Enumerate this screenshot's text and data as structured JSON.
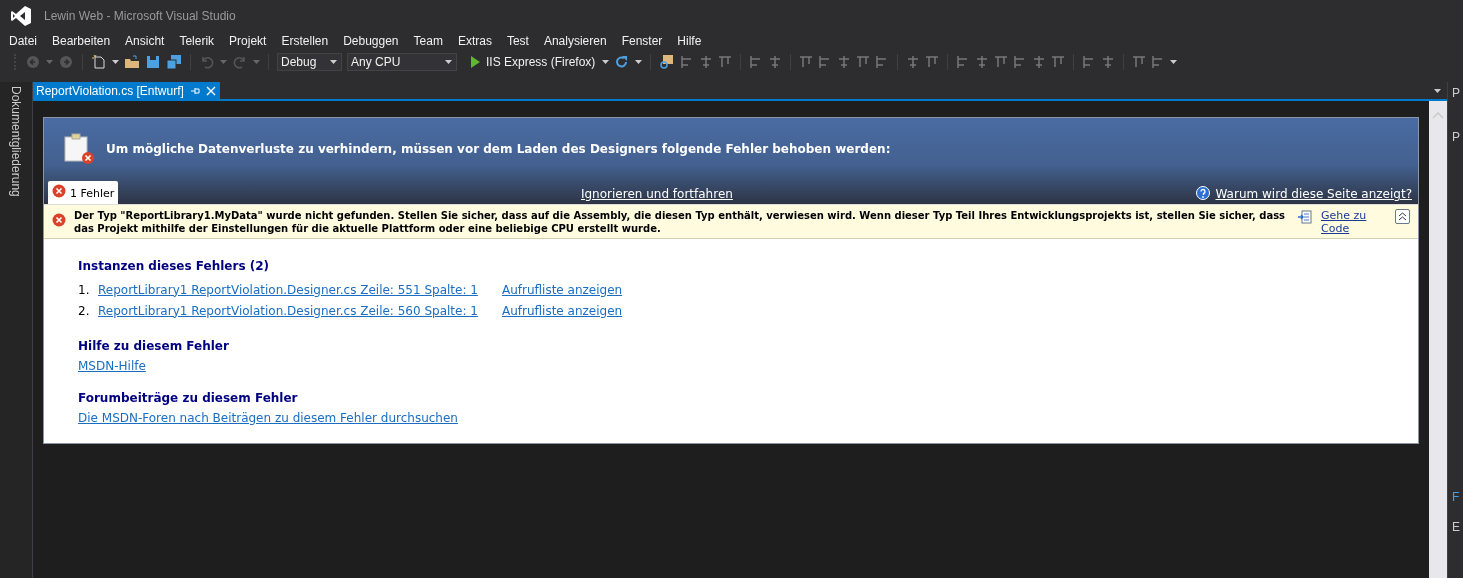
{
  "window": {
    "title": "Lewin Web - Microsoft Visual Studio"
  },
  "menu": [
    "Datei",
    "Bearbeiten",
    "Ansicht",
    "Telerik",
    "Projekt",
    "Erstellen",
    "Debuggen",
    "Team",
    "Extras",
    "Test",
    "Analysieren",
    "Fenster",
    "Hilfe"
  ],
  "toolbar": {
    "configuration": "Debug",
    "platform": "Any CPU",
    "run_target": "IIS Express (Firefox)"
  },
  "tabs": [
    {
      "label": "ReportViolation.cs [Entwurf]",
      "selected": true
    }
  ],
  "side_panel": {
    "label": "Dokumentgliederung"
  },
  "designer_error": {
    "heading": "Um mögliche Datenverluste zu verhindern, müssen vor dem Laden des Designers folgende Fehler behoben werden:",
    "error_tab": "1 Fehler",
    "ignore_link": "Ignorieren und fortfahren",
    "why_link": "Warum wird diese Seite anzeigt?",
    "message": "Der Typ \"ReportLibrary1.MyData\" wurde nicht gefunden. Stellen Sie sicher, dass auf die Assembly, die diesen Typ enthält, verwiesen wird. Wenn dieser Typ Teil Ihres Entwicklungsprojekts ist, stellen Sie sicher, dass das Projekt mithilfe der Einstellungen für die aktuelle Plattform oder eine beliebige CPU erstellt wurde.",
    "goto_code": "Gehe zu Code",
    "instances_heading": "Instanzen dieses Fehlers (2)",
    "instances": [
      {
        "number": "1.",
        "location": "ReportLibrary1 ReportViolation.Designer.cs Zeile: 551 Spalte: 1",
        "call_stack": "Aufrufliste anzeigen"
      },
      {
        "number": "2.",
        "location": "ReportLibrary1 ReportViolation.Designer.cs Zeile: 560 Spalte: 1",
        "call_stack": "Aufrufliste anzeigen"
      }
    ],
    "help_heading": "Hilfe zu diesem Fehler",
    "help_link": "MSDN-Hilfe",
    "forum_heading": "Forumbeiträge zu diesem Fehler",
    "forum_link": "Die MSDN-Foren nach Beiträgen zu diesem Fehler durchsuchen"
  },
  "right_panel": {
    "labels": [
      "P",
      "P",
      "F",
      "E"
    ]
  }
}
